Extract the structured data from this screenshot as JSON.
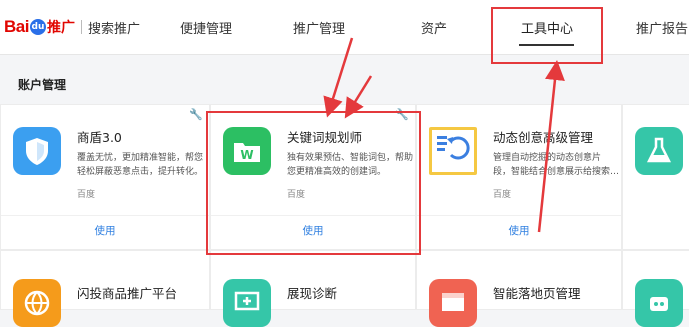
{
  "header": {
    "logo_text": "Bai",
    "logo_paw": "du",
    "logo_suffix": "推广",
    "product": "搜索推广",
    "nav": [
      {
        "label": "便捷管理"
      },
      {
        "label": "推广管理"
      },
      {
        "label": "资产"
      },
      {
        "label": "工具中心",
        "active": true
      },
      {
        "label": "推广报告"
      }
    ]
  },
  "section": {
    "title": "账户管理"
  },
  "cards": [
    {
      "title": "商盾3.0",
      "desc_line1": "覆盖无忧，更加精准智能，帮您",
      "desc_line2": "轻松屏蔽恶意点击，提升转化。",
      "maker": "百度",
      "use": "使用",
      "icon": "shield-icon",
      "color": "#3b9ff0"
    },
    {
      "title": "关键词规划师",
      "desc_line1": "独有效果预估、智能词包，帮助",
      "desc_line2": "您更精准高效的创建词。",
      "maker": "百度",
      "use": "使用",
      "icon": "folder-w-icon",
      "color": "#2cbf63"
    },
    {
      "title": "动态创意高级管理",
      "desc_line1": "管理自动挖掘的动态创意片",
      "desc_line2": "段，智能结合创意展示给搜索…",
      "maker": "百度",
      "use": "使用",
      "icon": "document-refresh-icon",
      "color": "#f5c842"
    },
    {
      "title": "",
      "icon": "flask-icon",
      "color": "#35c6a8"
    },
    {
      "title": "闪投商品推广平台",
      "icon": "globe-icon",
      "color": "#f59b1b"
    },
    {
      "title": "展现诊断",
      "icon": "monitor-plus-icon",
      "color": "#35c6a8"
    },
    {
      "title": "智能落地页管理",
      "icon": "webpage-icon",
      "color": "#f06352"
    },
    {
      "title": "",
      "icon": "robot-icon",
      "color": "#35c6a8"
    }
  ],
  "colors": {
    "accent": "#2f7fe0",
    "highlight": "#e4393c",
    "brand_red": "#e10601"
  }
}
